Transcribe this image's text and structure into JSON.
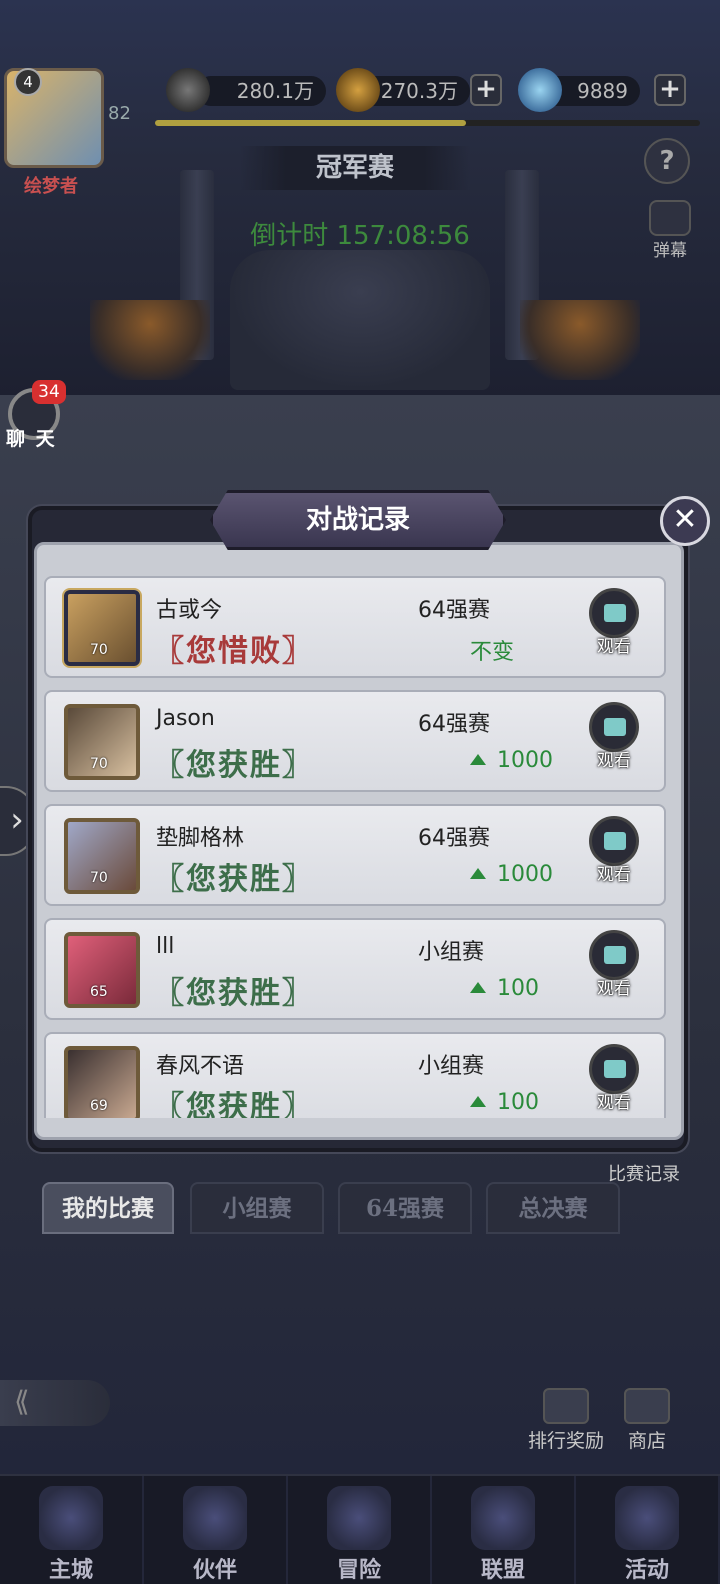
{
  "top_bar": {
    "avatar_level": "4",
    "player_level": "82",
    "player_name": "绘梦者",
    "power_value": "280.1万",
    "gold_value": "270.3万",
    "diamond_value": "9889",
    "exp_progress": 0.57,
    "power_icon": "sword-icon",
    "gold_icon": "coin-icon",
    "diamond_icon": "diamond-icon"
  },
  "event": {
    "title": "冠军赛",
    "countdown": "倒计时 157:08:56",
    "help_label": "?",
    "danmaku_label": "弹幕"
  },
  "chat": {
    "badge": "34",
    "label": "聊 天"
  },
  "dialog": {
    "title": "对战记录",
    "close_label": "✕",
    "watch_label": "观看",
    "records": [
      {
        "name": "古或今",
        "level": "70",
        "result": "〖您惜败〗",
        "outcome": "loss",
        "stage": "64强赛",
        "change": "不变",
        "up": false
      },
      {
        "name": "Jason",
        "level": "70",
        "result": "〖您获胜〗",
        "outcome": "win",
        "stage": "64强赛",
        "change": "1000",
        "up": true
      },
      {
        "name": "垫脚格林",
        "level": "70",
        "result": "〖您获胜〗",
        "outcome": "win",
        "stage": "64强赛",
        "change": "1000",
        "up": true
      },
      {
        "name": "lll",
        "level": "65",
        "result": "〖您获胜〗",
        "outcome": "win",
        "stage": "小组赛",
        "change": "100",
        "up": true
      },
      {
        "name": "春风不语",
        "level": "69",
        "result": "〖您获胜〗",
        "outcome": "win",
        "stage": "小组赛",
        "change": "100",
        "up": true
      }
    ]
  },
  "tabs": {
    "my_match": "我的比赛",
    "group": "小组赛",
    "top64": "64强赛",
    "final": "总决赛",
    "record_link": "比赛记录"
  },
  "side_actions": {
    "rank_reward": "排行奖励",
    "shop": "商店"
  },
  "bottom_nav": {
    "main_city": "主城",
    "partner": "伙伴",
    "adventure": "冒险",
    "alliance": "联盟",
    "activity": "活动"
  },
  "colors": {
    "win": "#3d6e4a",
    "loss": "#a83a3a",
    "gain": "#2a8a3a",
    "countdown": "#3d8a3d"
  }
}
